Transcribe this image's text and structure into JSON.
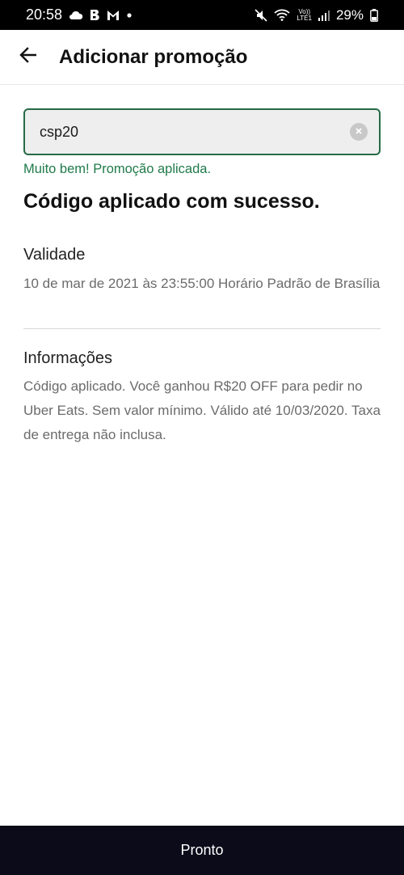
{
  "status_bar": {
    "time": "20:58",
    "left_icons": [
      "cloud-icon",
      "b-app-icon",
      "gmail-icon",
      "dot-icon"
    ],
    "volte_top": "Vo))",
    "volte_bottom": "LTE1",
    "battery_percent": "29%",
    "right_icons": [
      "mute-icon",
      "wifi-icon",
      "signal-icon",
      "battery-icon"
    ]
  },
  "app_bar": {
    "title": "Adicionar promoção",
    "back_icon": "arrow-left-icon"
  },
  "promo": {
    "value": "csp20",
    "success_message": "Muito bem! Promoção aplicada.",
    "headline": "Código aplicado com sucesso."
  },
  "validity": {
    "title": "Validade",
    "text": "10 de mar de 2021 às 23:55:00 Horário Padrão de Brasília"
  },
  "info": {
    "title": "Informações",
    "text": "Código aplicado. Você ganhou R$20 OFF para pedir no Uber Eats. Sem valor mínimo. Válido até 10/03/2020. Taxa de entrega não inclusa."
  },
  "footer": {
    "done_label": "Pronto"
  },
  "colors": {
    "accent_green": "#276a47",
    "success_text": "#1f7a4a",
    "button_bg": "#0b0b1a"
  }
}
